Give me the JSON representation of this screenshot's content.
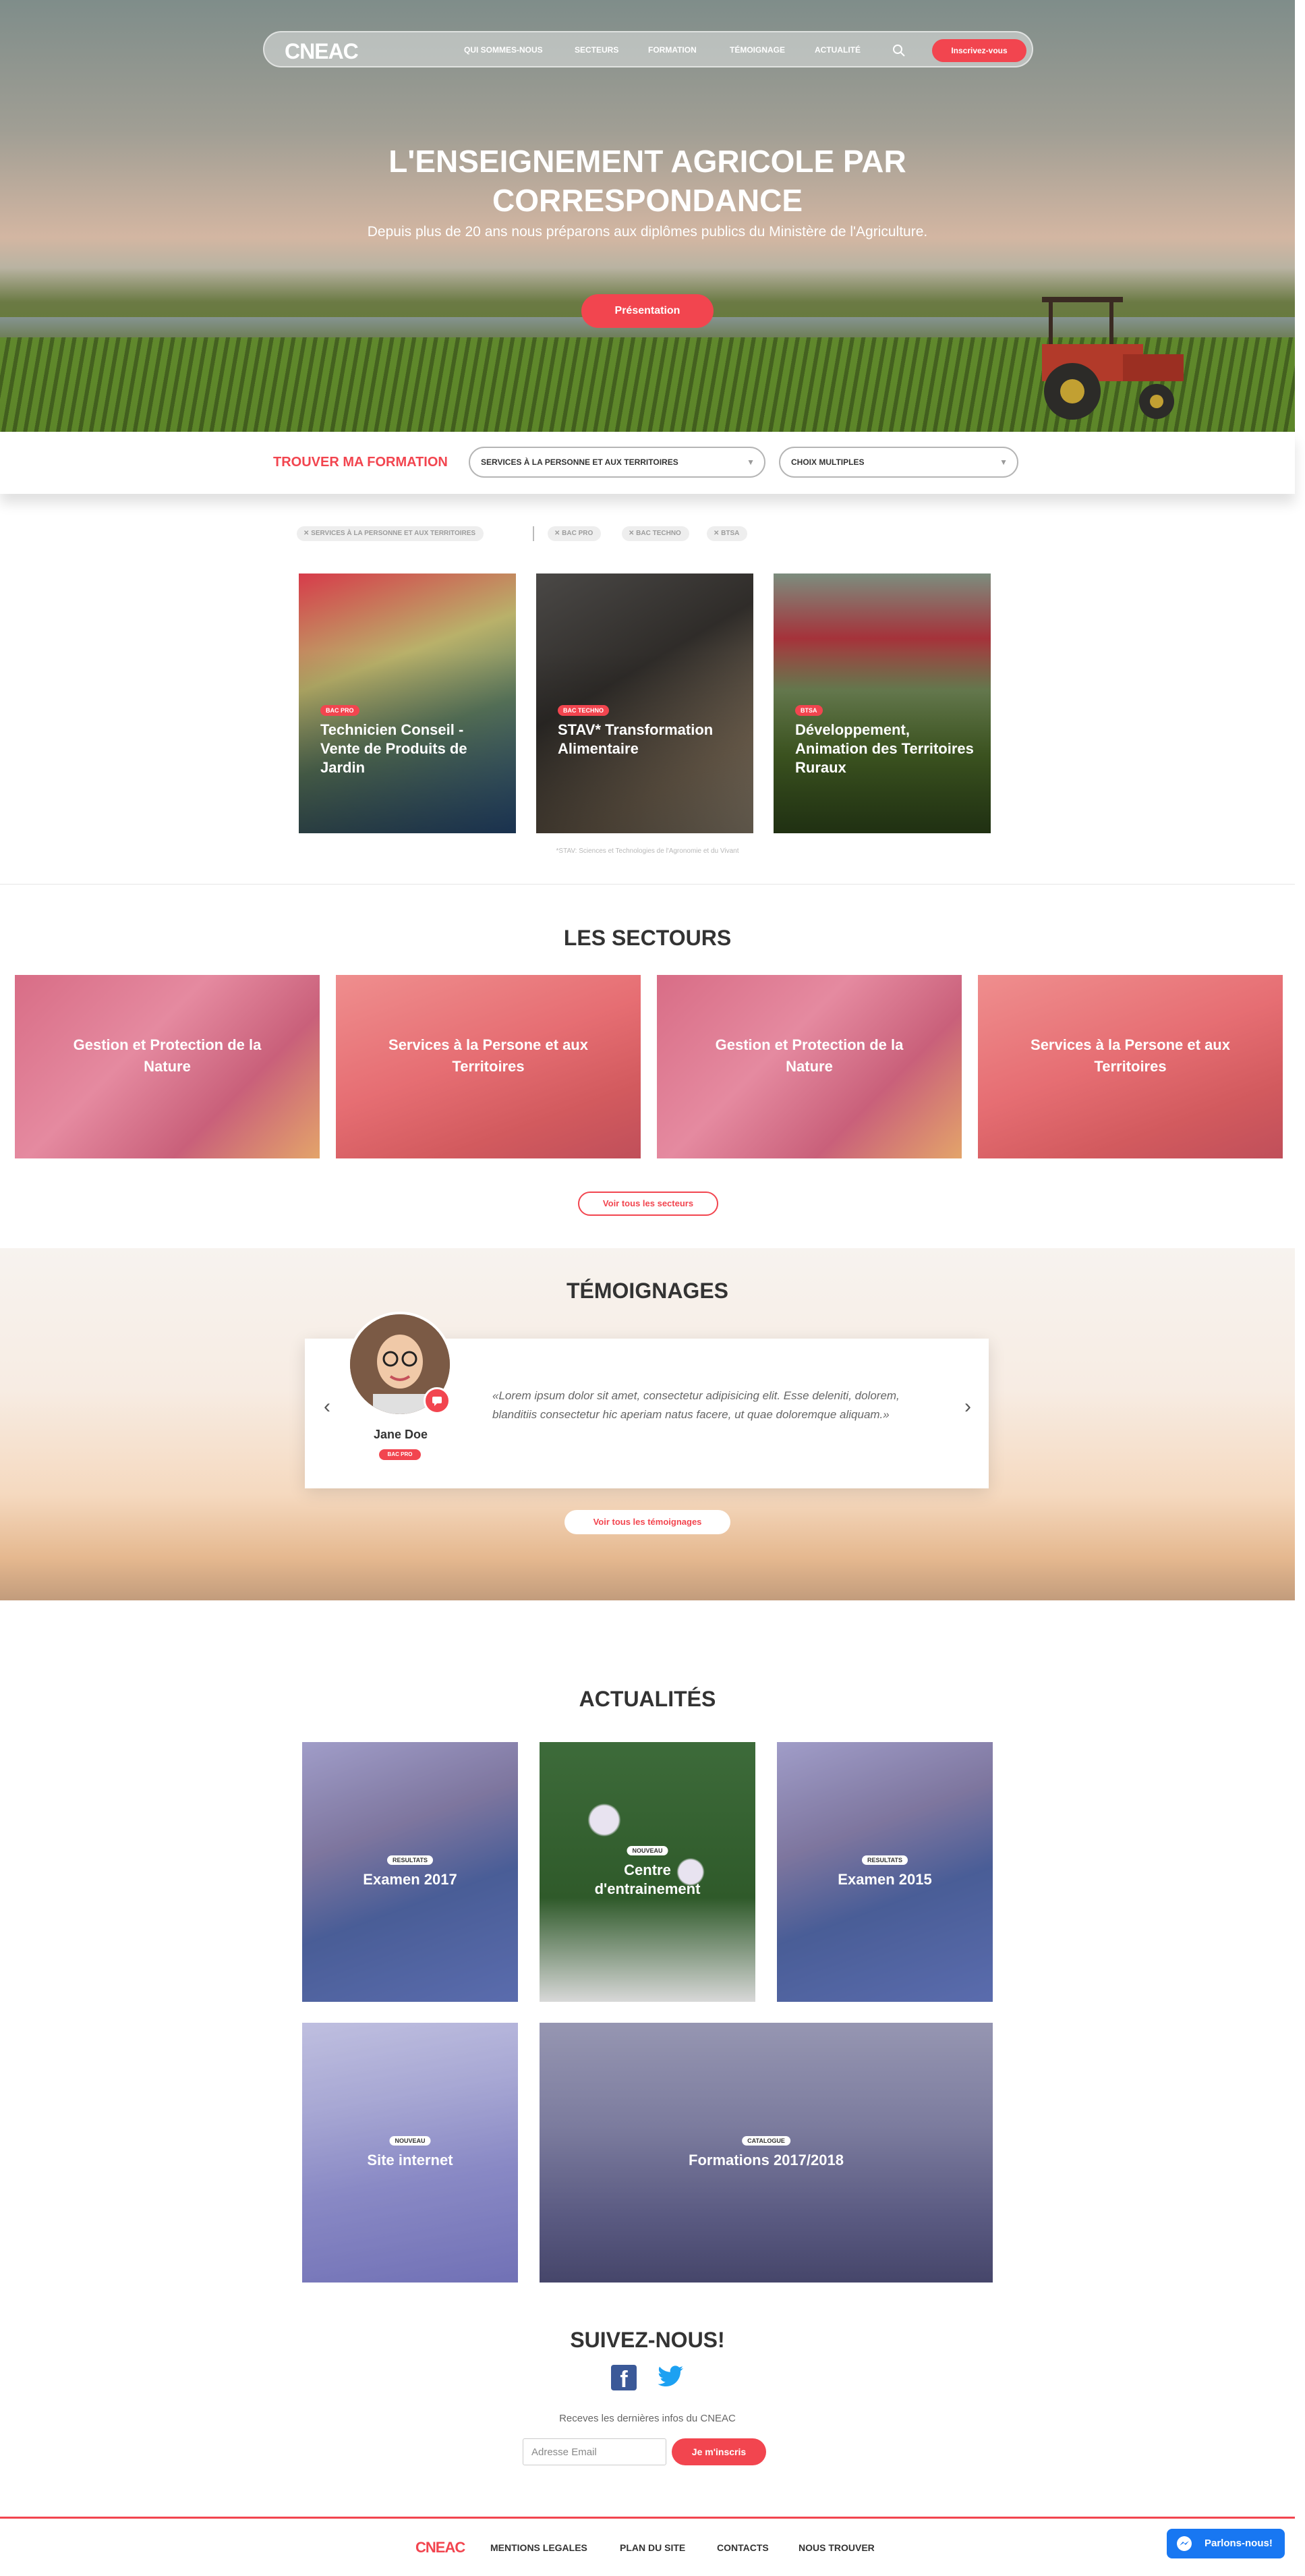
{
  "colors": {
    "accent": "#f2454f",
    "text": "#333333",
    "facebook": "#3b5998",
    "messenger": "#1877f2"
  },
  "nav": {
    "logo": "CNEAC",
    "items": [
      "QUI SOMMES-NOUS",
      "SECTEURS",
      "FORMATION",
      "TÉMOIGNAGE",
      "ACTUALITÉ"
    ],
    "search_icon": "search-icon",
    "cta": "Inscrivez-vous"
  },
  "hero": {
    "title": "L'ENSEIGNEMENT AGRICOLE PAR CORRESPONDANCE",
    "subtitle": "Depuis plus de 20 ans nous préparons aux diplômes publics du Ministère de l'Agriculture.",
    "button": "Présentation"
  },
  "finder": {
    "label": "TROUVER MA FORMATION",
    "select1": "SERVICES À LA PERSONNE ET AUX TERRITOIRES",
    "select2": "CHOIX MULTIPLES"
  },
  "filters": [
    "SERVICES À LA PERSONNE ET AUX TERRITOIRES",
    "BAC PRO",
    "BAC TECHNO",
    "BTSA"
  ],
  "courses": [
    {
      "badge": "BAC PRO",
      "title": "Technicien Conseil - Vente de Produits de Jardin"
    },
    {
      "badge": "BAC TECHNO",
      "title": "STAV* Transformation Alimentaire"
    },
    {
      "badge": "BTSA",
      "title": "Développement, Animation des Territoires Ruraux"
    }
  ],
  "footnote": "*STAV: Sciences et Technologies de l'Agronomie et du Vivant",
  "sectors": {
    "title": "LES SECTOURS",
    "items": [
      "Gestion et Protection de la Nature",
      "Services à la Persone et aux Territoires",
      "Gestion et Protection de la Nature",
      "Services à la Persone et aux Territoires"
    ],
    "button": "Voir tous les secteurs"
  },
  "testimonials": {
    "title": "TÉMOIGNAGES",
    "name": "Jane Doe",
    "tag": "BAC PRO",
    "quote": "«Lorem ipsum dolor sit amet, consectetur adipisicing elit. Esse deleniti, dolorem, blanditiis consectetur hic aperiam natus facere, ut quae doloremque aliquam.»",
    "button": "Voir tous les témoignages"
  },
  "news": {
    "title": "ACTUALITÉS",
    "items": [
      {
        "badge": "RESULTATS",
        "title": "Examen 2017"
      },
      {
        "badge": "NOUVEAU",
        "title": "Centre d'entrainement"
      },
      {
        "badge": "RESULTATS",
        "title": "Examen 2015"
      },
      {
        "badge": "NOUVEAU",
        "title": "Site internet"
      },
      {
        "badge": "CATALOGUE",
        "title": "Formations 2017/2018"
      }
    ]
  },
  "follow": {
    "title": "SUIVEZ-NOUS!",
    "newsletter_text": "Receves les dernières infos du CNEAC",
    "email_placeholder": "Adresse Email",
    "subscribe": "Je m'inscris"
  },
  "footer": {
    "logo": "CNEAC",
    "links": [
      "MENTIONS LEGALES",
      "PLAN DU SITE",
      "CONTACTS",
      "NOUS TROUVER"
    ],
    "chat": "Parlons-nous!"
  }
}
